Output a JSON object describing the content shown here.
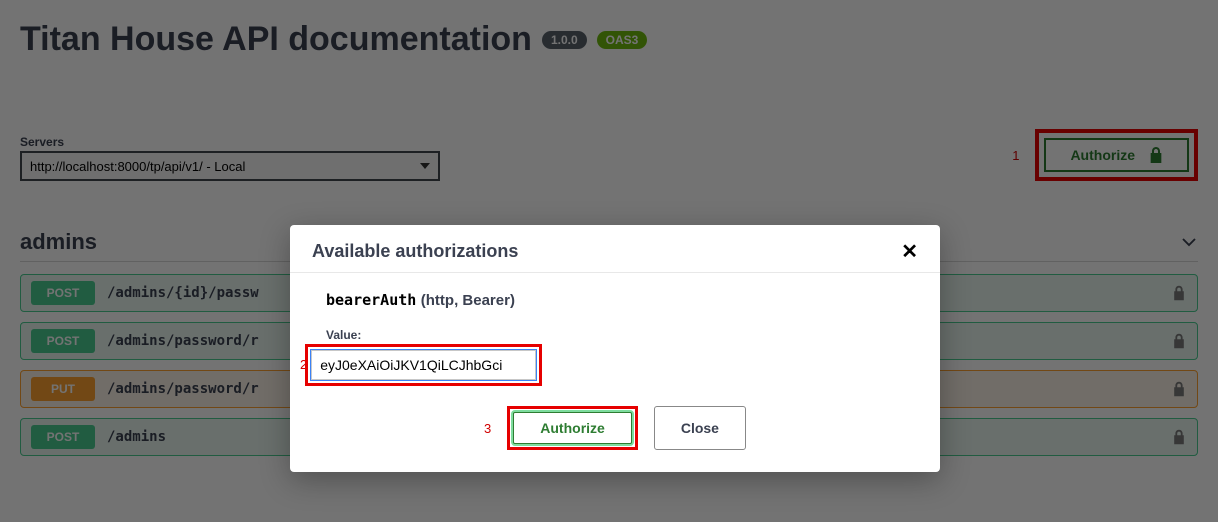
{
  "header": {
    "title": "Titan House API documentation",
    "version": "1.0.0",
    "oas": "OAS3"
  },
  "servers": {
    "label": "Servers",
    "selected": "http://localhost:8000/tp/api/v1/ - Local"
  },
  "authorize_button": {
    "label": "Authorize"
  },
  "annotations": {
    "one": "1",
    "two": "2",
    "three": "3"
  },
  "section": {
    "name": "admins"
  },
  "ops": [
    {
      "method": "POST",
      "path": "/admins/{id}/passw"
    },
    {
      "method": "POST",
      "path": "/admins/password/r"
    },
    {
      "method": "PUT",
      "path": "/admins/password/r"
    },
    {
      "method": "POST",
      "path": "/admins"
    }
  ],
  "modal": {
    "title": "Available authorizations",
    "scheme_name": "bearerAuth",
    "scheme_extra": "(http, Bearer)",
    "value_label": "Value:",
    "value": "eyJ0eXAiOiJKV1QiLCJhbGci",
    "authorize": "Authorize",
    "close": "Close"
  }
}
